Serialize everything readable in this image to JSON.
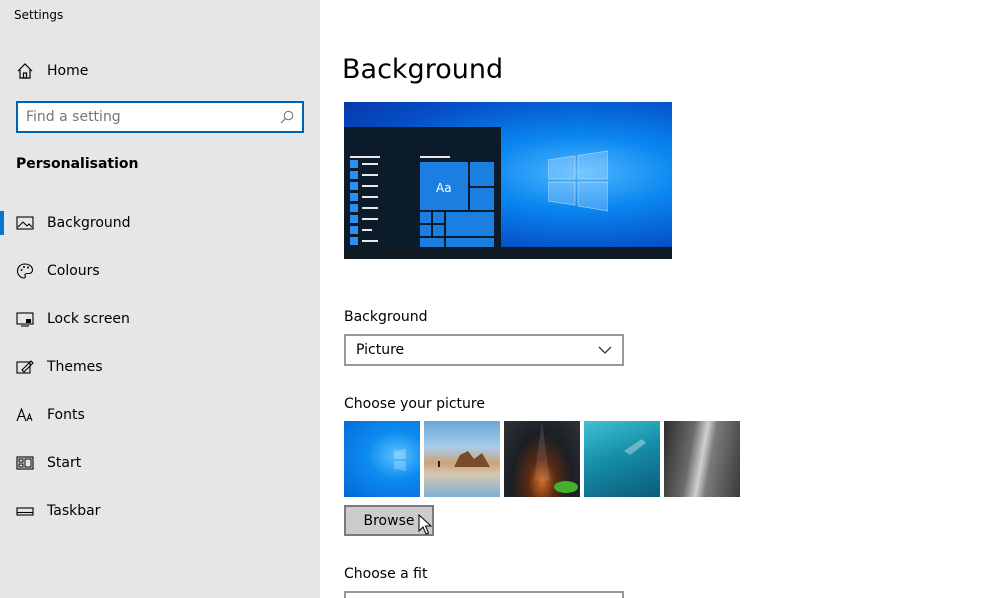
{
  "window": {
    "title": "Settings"
  },
  "sidebar": {
    "home_label": "Home",
    "search_placeholder": "Find a setting",
    "section": "Personalisation",
    "items": [
      {
        "label": "Background",
        "icon": "picture-icon",
        "active": true
      },
      {
        "label": "Colours",
        "icon": "palette-icon",
        "active": false
      },
      {
        "label": "Lock screen",
        "icon": "lock-screen-icon",
        "active": false
      },
      {
        "label": "Themes",
        "icon": "themes-icon",
        "active": false
      },
      {
        "label": "Fonts",
        "icon": "fonts-icon",
        "active": false
      },
      {
        "label": "Start",
        "icon": "start-icon",
        "active": false
      },
      {
        "label": "Taskbar",
        "icon": "taskbar-icon",
        "active": false
      }
    ]
  },
  "main": {
    "title": "Background",
    "preview_tile_label": "Aa",
    "background_label": "Background",
    "background_value": "Picture",
    "choose_picture_label": "Choose your picture",
    "browse_label": "Browse",
    "choose_fit_label": "Choose a fit"
  },
  "colors": {
    "accent": "#0078d7",
    "sidebar_bg": "#e6e6e6",
    "button_bg": "#cccccc"
  }
}
